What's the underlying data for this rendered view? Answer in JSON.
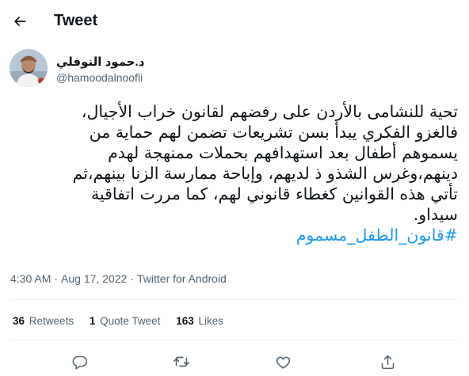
{
  "header": {
    "title": "Tweet",
    "back_icon": "arrow-left-icon"
  },
  "author": {
    "display_name": "د.حمود النوفلي",
    "handle": "@hamoodalnoofli"
  },
  "tweet": {
    "lines": [
      "تحية للنشامى بالأردن على رفضهم لقانون خراب الأجيال،",
      "فالغزو الفكري يبدأ بسن تشريعات تضمن لهم حماية من",
      "يسموهم أطفال بعد استهدافهم بحملات ممنهجة لهدم",
      "دينهم،وغرس الشذو ذ لديهم، وإباحة ممارسة الزنا بينهم،ثم",
      "تأتي هذه القوانين كغطاء قانوني لهم، كما مررت اتفاقية",
      "سيداو."
    ],
    "hashtag": "#قانون_الطفل_مسموم"
  },
  "meta": {
    "time": "4:30 AM",
    "date": "Aug 17, 2022",
    "separator": "·",
    "source": "Twitter for Android"
  },
  "stats": {
    "retweets_count": "36",
    "retweets_label": "Retweets",
    "quotes_count": "1",
    "quotes_label": "Quote Tweet",
    "likes_count": "163",
    "likes_label": "Likes"
  },
  "actions": [
    "reply-icon",
    "retweet-icon",
    "like-icon",
    "share-icon"
  ],
  "colors": {
    "text": "#0f1419",
    "secondary": "#536471",
    "link": "#1d9bf0",
    "divider": "#eff3f4"
  }
}
